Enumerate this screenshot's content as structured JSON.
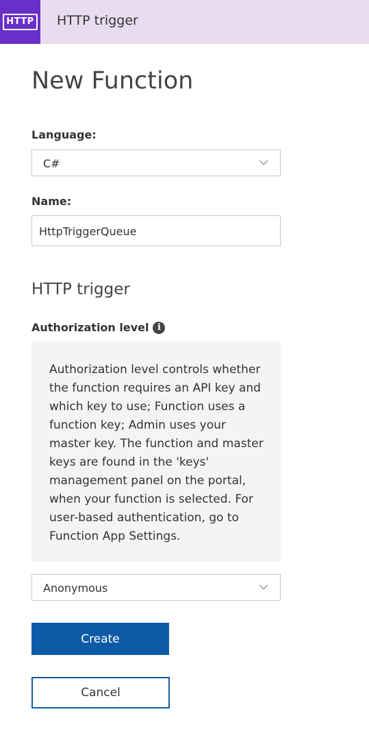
{
  "header": {
    "logo_text": "HTTP",
    "title": "HTTP trigger"
  },
  "page_title": "New Function",
  "language": {
    "label": "Language:",
    "value": "C#"
  },
  "name": {
    "label": "Name:",
    "value": "HttpTriggerQueue"
  },
  "section_title": "HTTP trigger",
  "authorization": {
    "label": "Authorization level",
    "info_icon": "info-icon",
    "help_text": "Authorization level controls whether the function requires an API key and which key to use; Function uses a function key; Admin uses your master key. The function and master keys are found in the 'keys' management panel on the portal, when your function is selected. For user-based authentication, go to Function App Settings.",
    "value": "Anonymous"
  },
  "buttons": {
    "create": "Create",
    "cancel": "Cancel"
  },
  "colors": {
    "header_bg": "#e8dcf1",
    "logo_bg": "#6a2fc9",
    "primary": "#0f5aa7"
  }
}
